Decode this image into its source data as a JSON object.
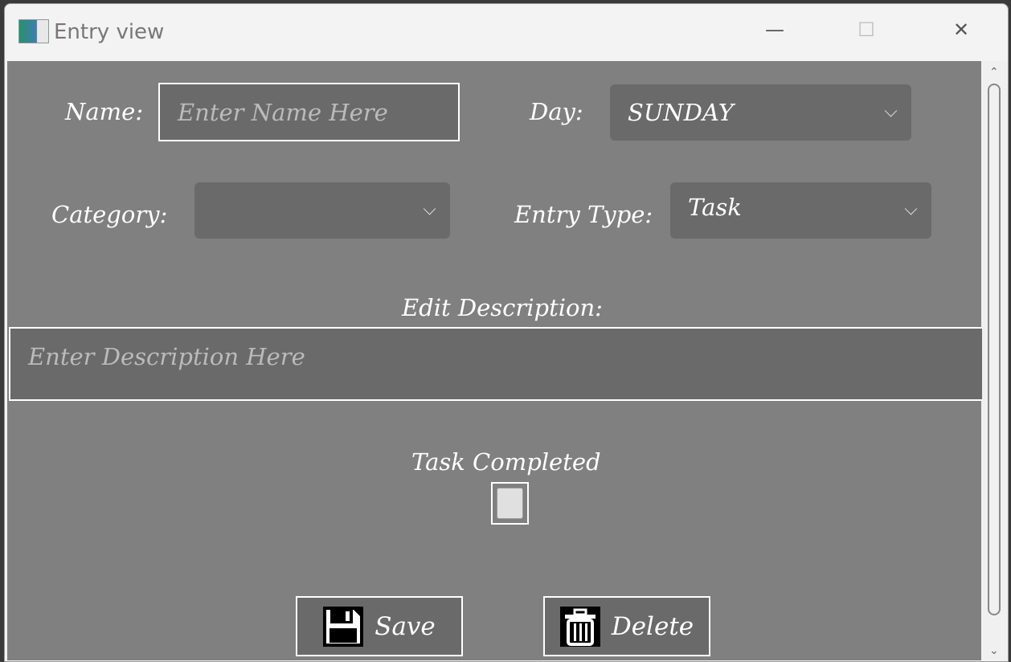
{
  "window": {
    "title": "Entry view",
    "minimize": "—",
    "maximize": "☐",
    "close": "✕"
  },
  "form": {
    "name_label": "Name:",
    "name_placeholder": "Enter Name Here",
    "day_label": "Day:",
    "day_value": "SUNDAY",
    "category_label": "Category:",
    "category_value": "",
    "entry_type_label": "Entry Type:",
    "entry_type_value": "Task",
    "description_label": "Edit Description:",
    "description_placeholder": "Enter Description Here",
    "task_completed_label": "Task Completed",
    "task_completed": false
  },
  "buttons": {
    "save": "Save",
    "delete": "Delete"
  }
}
